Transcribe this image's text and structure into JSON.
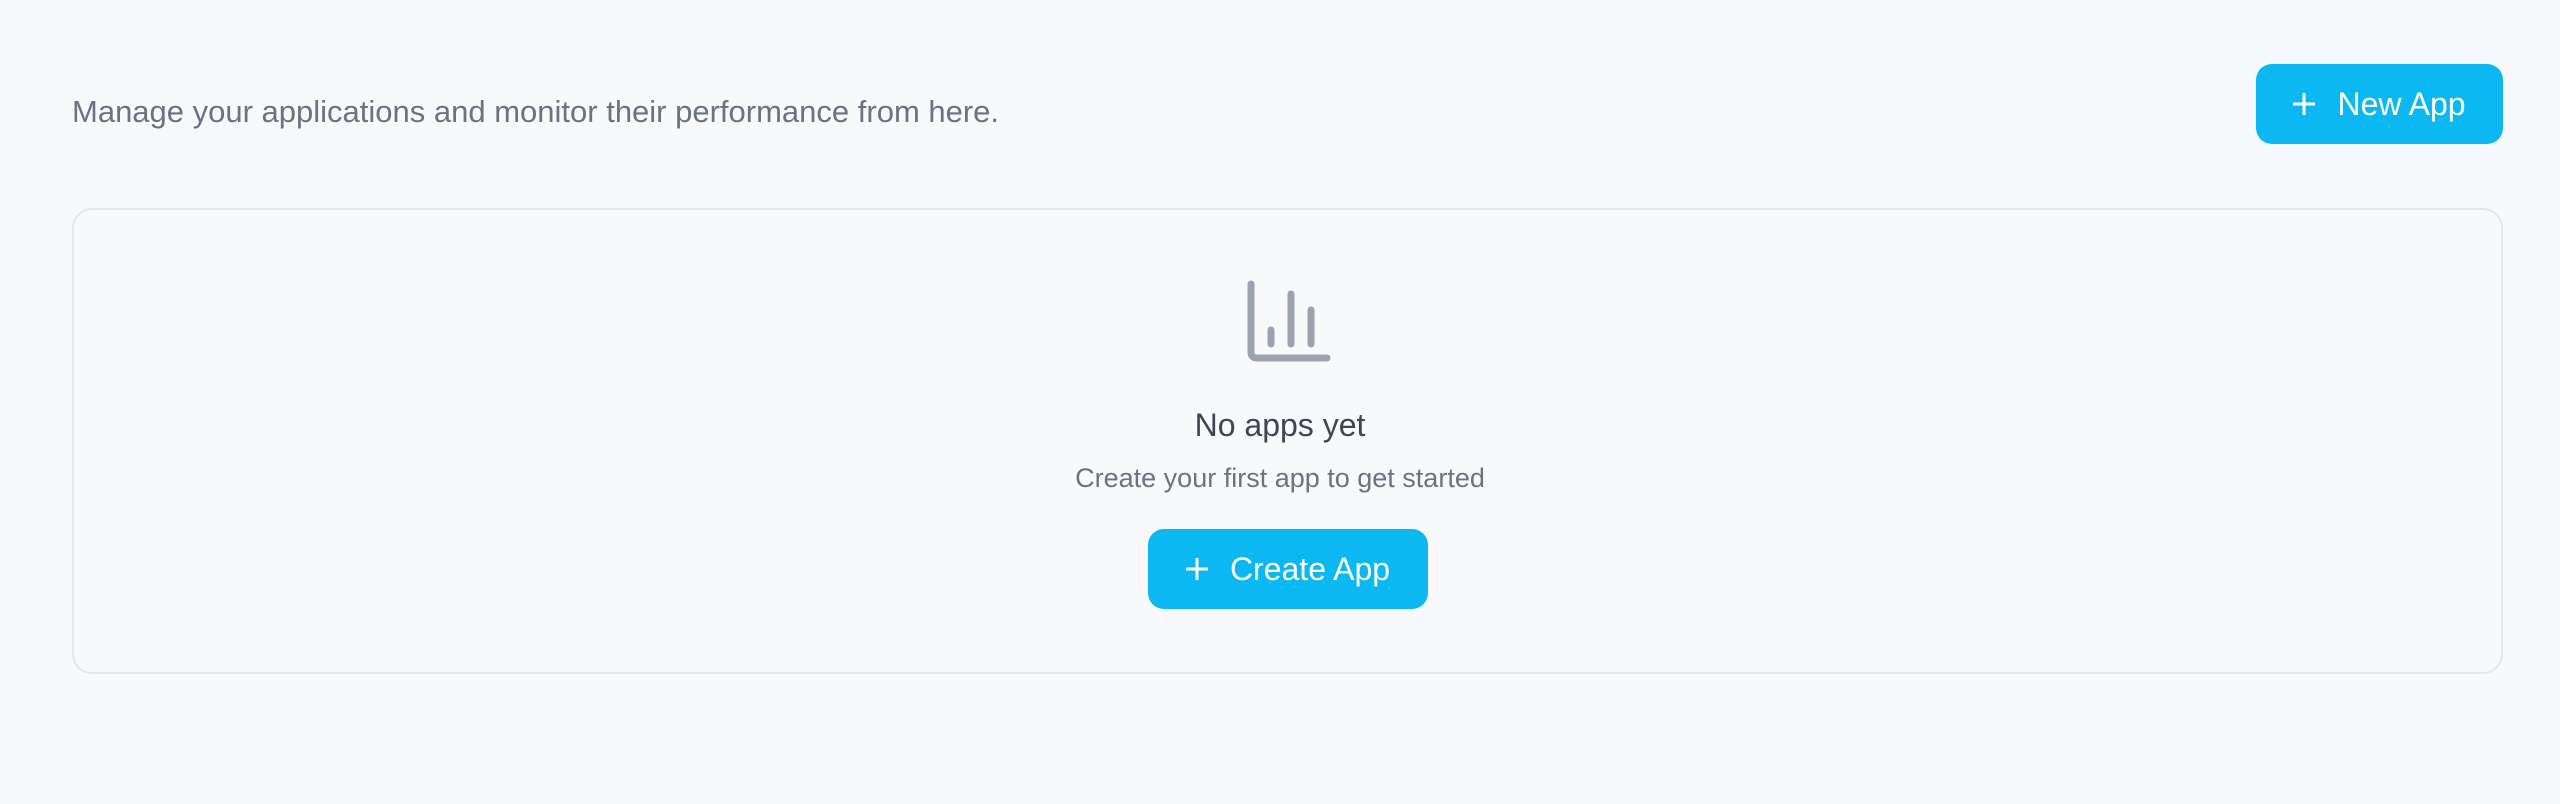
{
  "header": {
    "description": "Manage your applications and monitor their performance from here.",
    "new_app_label": "New App",
    "new_app_icon": "plus-icon"
  },
  "empty_state": {
    "icon": "bar-chart-icon",
    "title": "No apps yet",
    "subtitle": "Create your first app to get started",
    "create_label": "Create App",
    "create_icon": "plus-icon"
  },
  "colors": {
    "accent": "#0bb8f2",
    "background": "#f8f9fb",
    "muted_text": "#6b7280",
    "heading_text": "#3f4652",
    "icon_gray": "#9ca3af",
    "border": "#e3e6ea"
  }
}
